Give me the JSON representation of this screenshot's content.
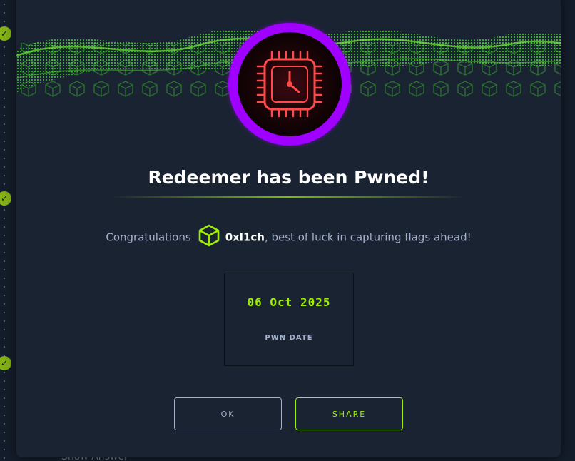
{
  "modal": {
    "title": "Redeemer has been Pwned!",
    "congrats_prefix": "Congratulations",
    "username": "0xl1ch",
    "congrats_suffix": ", best of luck in capturing flags ahead!",
    "pwn_date": "06 Oct 2025",
    "pwn_date_label": "PWN DATE",
    "ok_label": "OK",
    "share_label": "SHARE"
  },
  "background": {
    "partial_text": "Show Answer"
  },
  "icons": {
    "machine_avatar": "cpu-clock-icon",
    "user_rank": "cube-icon",
    "timeline_check": "checkmark-icon"
  },
  "colors": {
    "accent_green": "#9fef00",
    "avatar_ring": "#9f00ff",
    "modal_bg": "#1a2332",
    "page_bg": "#141d2b",
    "text_muted": "#a4b1cd",
    "avatar_chip": "#ff4a4a"
  }
}
